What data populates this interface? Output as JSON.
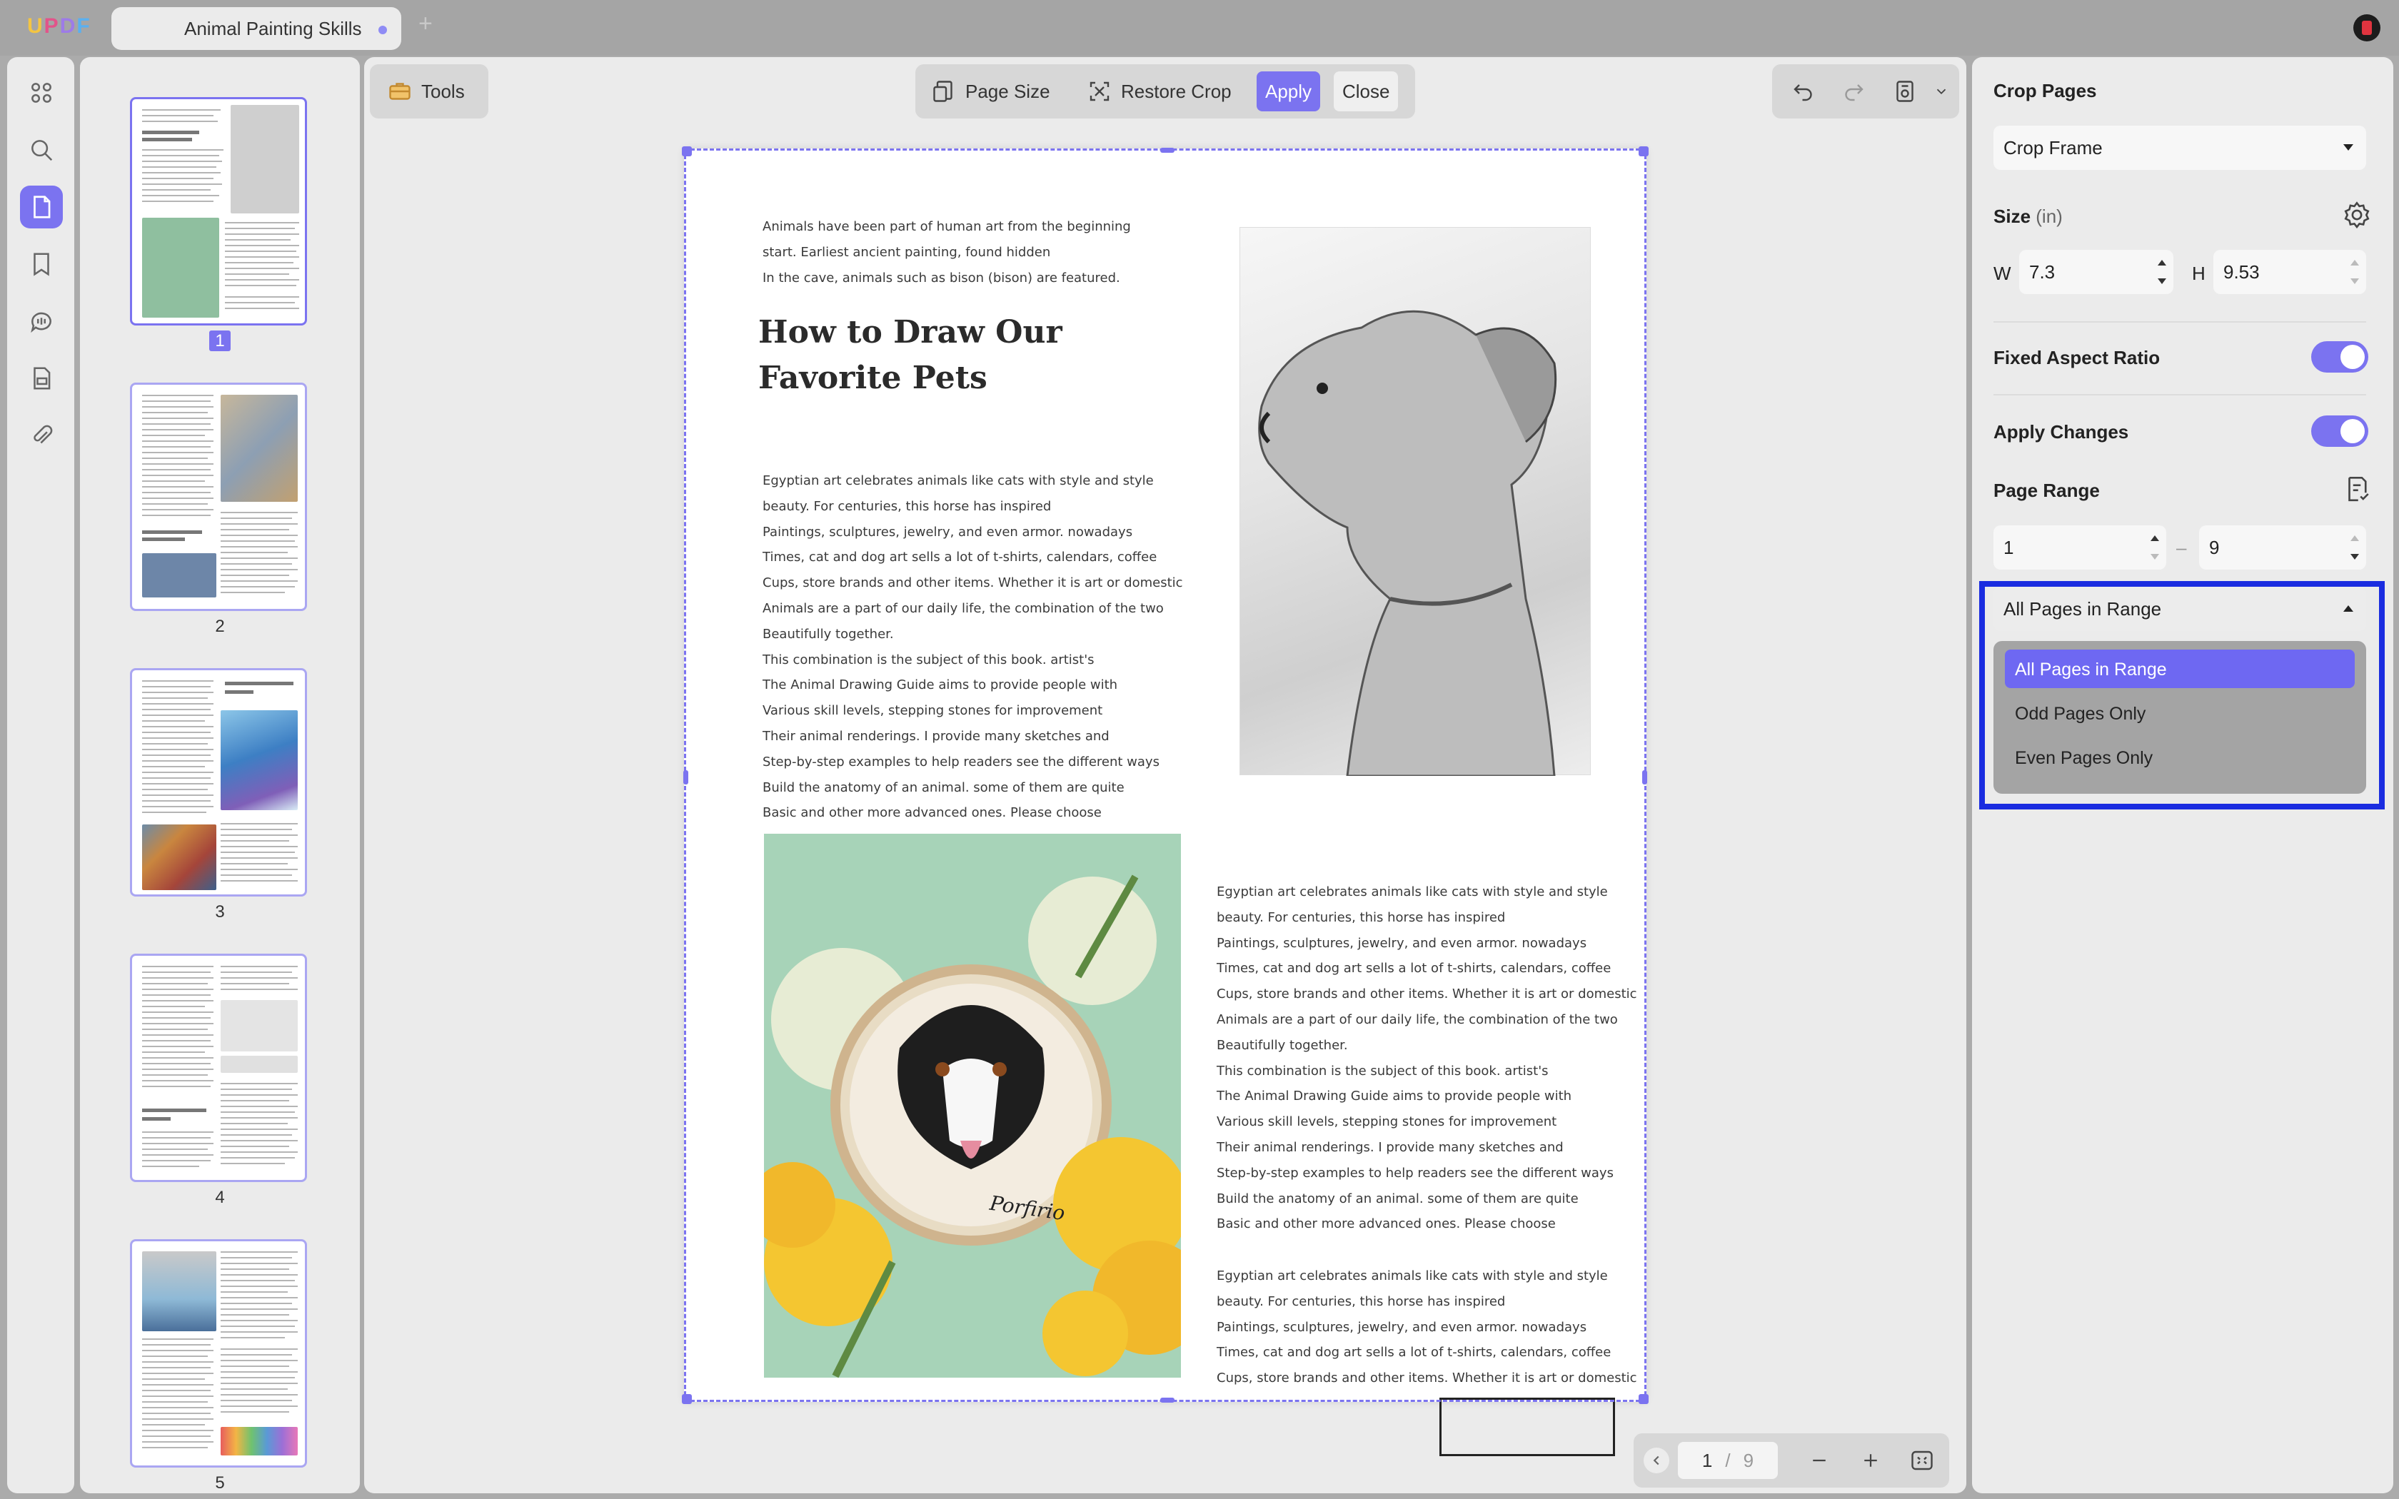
{
  "app": {
    "logo": "UPDF",
    "logo_colors": [
      "#f4c542",
      "#f49a42",
      "#e2548a",
      "#9d7be8",
      "#5ab0f0"
    ]
  },
  "tab": {
    "title": "Animal Painting Skills",
    "add_symbol": "+"
  },
  "rail": {
    "icons": [
      "grid-icon",
      "search-icon",
      "pages-icon",
      "bookmark-icon",
      "comment-icon",
      "form-icon",
      "attachment-icon"
    ],
    "active": "pages-icon"
  },
  "thumbnails": [
    {
      "number": "1",
      "current": true
    },
    {
      "number": "2",
      "current": false
    },
    {
      "number": "3",
      "current": false
    },
    {
      "number": "4",
      "current": false
    },
    {
      "number": "5",
      "current": false
    }
  ],
  "toolbar": {
    "tools_label": "Tools",
    "page_size_label": "Page Size",
    "restore_crop_label": "Restore Crop",
    "apply_label": "Apply",
    "close_label": "Close"
  },
  "page": {
    "intro": [
      "Animals have been part of human art from the beginning",
      "start. Earliest ancient painting, found hidden",
      "In the cave, animals such as bison (bison) are featured."
    ],
    "heading": "How to Draw Our Favorite Pets",
    "body_left": [
      "Egyptian art celebrates animals like cats with style and style",
      "beauty. For centuries, this horse has inspired",
      "Paintings, sculptures, jewelry, and even armor. nowadays",
      "Times, cat and dog art sells a lot of t-shirts, calendars, coffee",
      "Cups, store brands and other items. Whether it is art or domestic",
      "Animals are a part of our daily life, the combination of the two",
      "Beautifully together.",
      "This combination is the subject of this book. artist's",
      "The Animal Drawing Guide aims to provide people with",
      "Various skill levels, stepping stones for improvement",
      "Their animal renderings. I provide many sketches and",
      "Step-by-step examples to help readers see the different ways",
      "Build the anatomy of an animal. some of them are quite",
      "Basic and other more advanced ones. Please choose"
    ],
    "body_right": [
      "Egyptian art celebrates animals like cats with style and style",
      "beauty. For centuries, this horse has inspired",
      "Paintings, sculptures, jewelry, and even armor. nowadays",
      "Times, cat and dog art sells a lot of t-shirts, calendars, coffee",
      "Cups, store brands and other items. Whether it is art or domestic",
      "Animals are a part of our daily life, the combination of the two",
      "Beautifully together.",
      "This combination is the subject of this book. artist's",
      "The Animal Drawing Guide aims to provide people with",
      "Various skill levels, stepping stones for improvement",
      "Their animal renderings. I provide many sketches and",
      "Step-by-step examples to help readers see the different ways",
      "Build the anatomy of an animal. some of them are quite",
      "Basic and other more advanced ones. Please choose"
    ],
    "body_right_2": [
      "Egyptian art celebrates animals like cats with style and style",
      "beauty. For centuries, this horse has inspired",
      "Paintings, sculptures, jewelry, and even armor. nowadays",
      "Times, cat and dog art sells a lot of t-shirts, calendars, coffee",
      "Cups, store brands and other items. Whether it is art or domestic"
    ],
    "embroidery_caption": "Porfirio"
  },
  "pagenav": {
    "current": "1",
    "separator": "/",
    "total": "9"
  },
  "panel": {
    "title": "Crop Pages",
    "mode_select": "Crop Frame",
    "size_label": "Size",
    "size_unit": "(in)",
    "w_label": "W",
    "w_value": "7.3",
    "h_label": "H",
    "h_value": "9.53",
    "fixed_aspect_label": "Fixed Aspect Ratio",
    "fixed_aspect_on": true,
    "apply_changes_label": "Apply Changes",
    "apply_changes_on": true,
    "page_range_label": "Page Range",
    "range_from": "1",
    "range_dash": "–",
    "range_to": "9",
    "range_select": "All Pages in Range",
    "range_options": [
      "All Pages in Range",
      "Odd Pages Only",
      "Even Pages Only"
    ],
    "range_selected_index": 0
  },
  "colors": {
    "accent": "#7b73f0",
    "highlight": "#1a2ce0"
  }
}
